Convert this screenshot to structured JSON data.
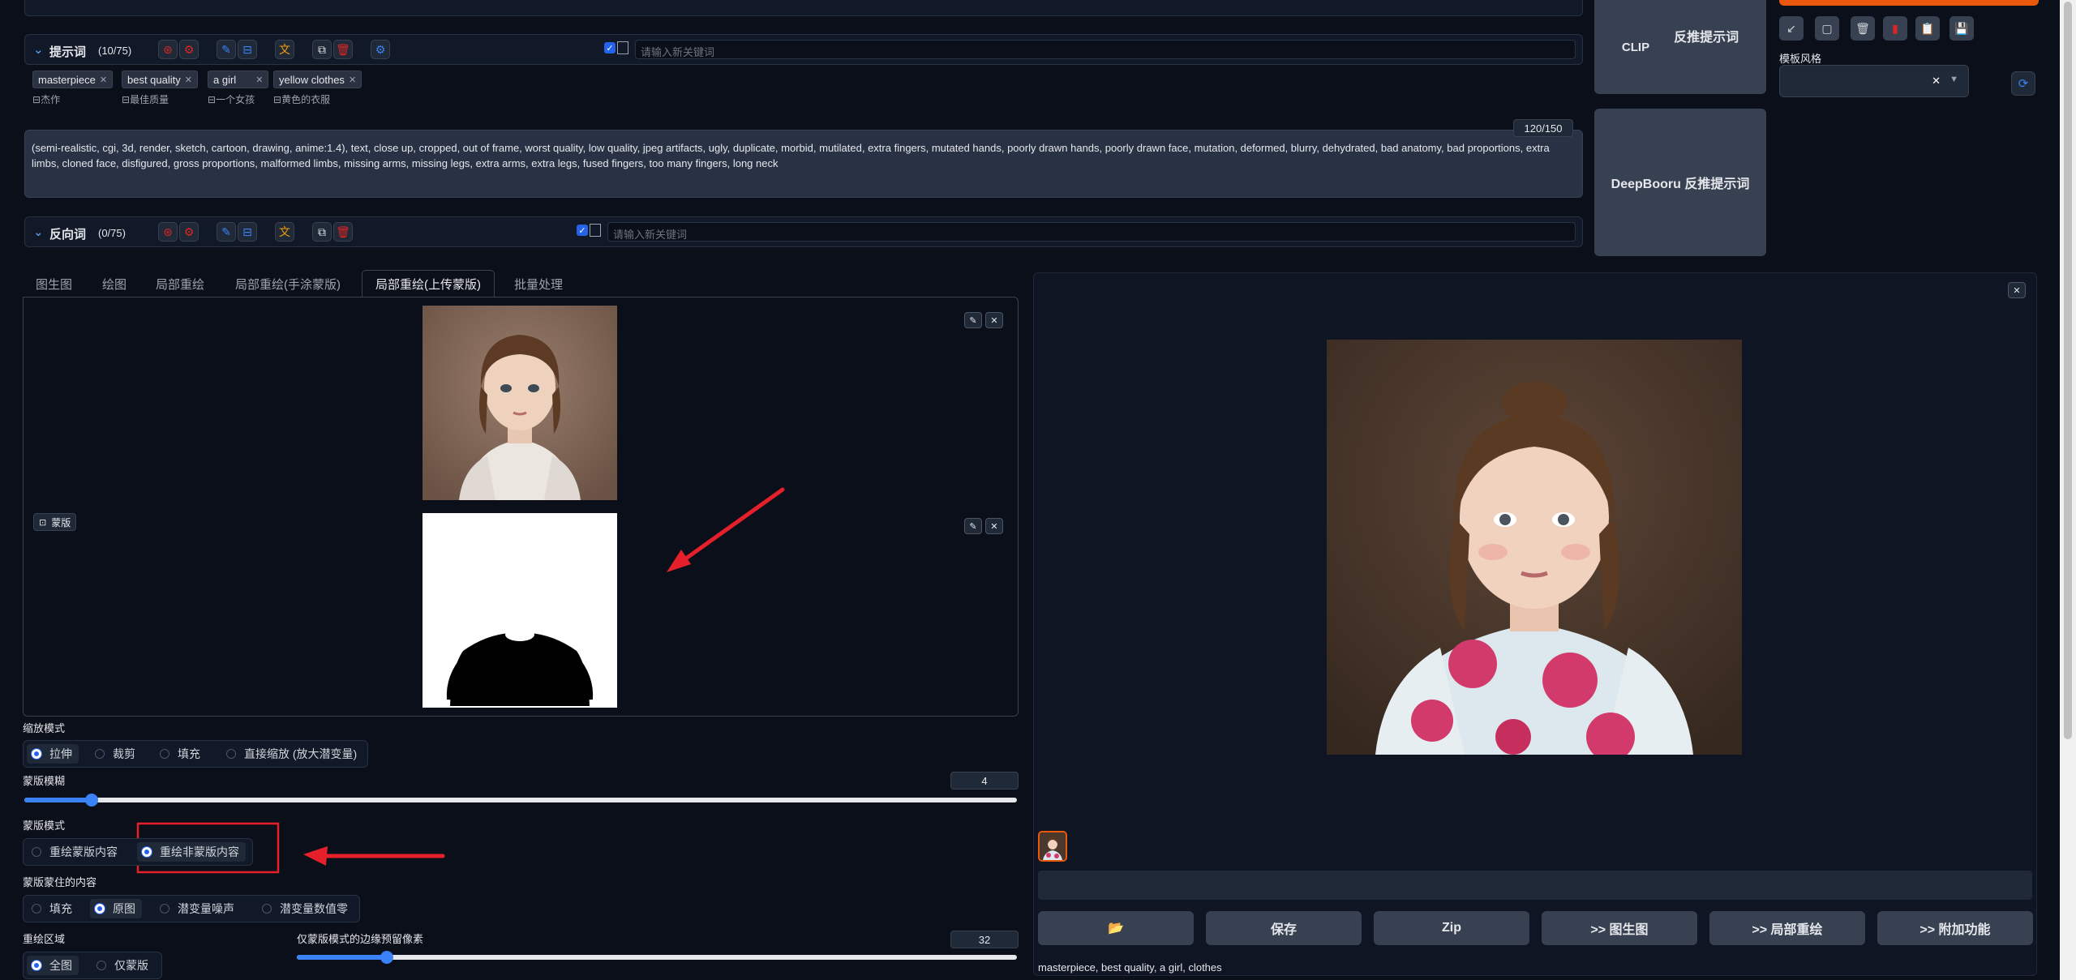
{
  "prompt": {
    "title": "提示词",
    "count": "(10/75)",
    "keyword_placeholder": "请输入新关键词",
    "tags": [
      {
        "text": "masterpiece",
        "translation": "杰作"
      },
      {
        "text": "best quality",
        "translation": "最佳质量"
      },
      {
        "text": "a girl",
        "translation": "一个女孩"
      },
      {
        "text": "yellow clothes",
        "translation": "黄色的衣服"
      }
    ]
  },
  "negative_textarea": {
    "counter": "120/150",
    "text": "(semi-realistic, cgi, 3d, render, sketch, cartoon, drawing, anime:1.4), text, close up, cropped, out of frame, worst quality, low quality, jpeg artifacts, ugly, duplicate, morbid, mutilated, extra fingers, mutated hands, poorly drawn hands, poorly drawn face, mutation, deformed, blurry, dehydrated, bad anatomy, bad proportions, extra limbs, cloned face, disfigured, gross proportions, malformed limbs, missing arms, missing legs, extra arms, extra legs, fused fingers, too many fingers, long neck"
  },
  "negative_prompt": {
    "title": "反向词",
    "count": "(0/75)",
    "keyword_placeholder": "请输入新关键词"
  },
  "interrogate": {
    "clip_label": "CLIP",
    "clip_action": "反推提示词",
    "deepbooru_label": "DeepBooru 反推提示词"
  },
  "style": {
    "label": "模板风格"
  },
  "tabs": [
    "图生图",
    "绘图",
    "局部重绘",
    "局部重绘(手涂蒙版)",
    "局部重绘(上传蒙版)",
    "批量处理"
  ],
  "active_tab": "局部重绘(上传蒙版)",
  "mask_label": "蒙版",
  "resize_mode": {
    "label": "缩放模式",
    "options": [
      "拉伸",
      "裁剪",
      "填充",
      "直接缩放 (放大潜变量)"
    ],
    "selected": "拉伸"
  },
  "mask_blur": {
    "label": "蒙版模糊",
    "value": "4",
    "fraction": 0.068
  },
  "mask_mode": {
    "label": "蒙版模式",
    "options": [
      "重绘蒙版内容",
      "重绘非蒙版内容"
    ],
    "selected": "重绘非蒙版内容"
  },
  "masked_content": {
    "label": "蒙版蒙住的内容",
    "options": [
      "填充",
      "原图",
      "潜变量噪声",
      "潜变量数值零"
    ],
    "selected": "原图"
  },
  "inpaint_area": {
    "label": "重绘区域",
    "options": [
      "全图",
      "仅蒙版"
    ],
    "selected": "全图"
  },
  "padding": {
    "label": "仅蒙版模式的边缘预留像素",
    "value": "32",
    "fraction": 0.125
  },
  "output": {
    "buttons": [
      "📂",
      "保存",
      "Zip",
      ">> 图生图",
      ">> 局部重绘",
      ">> 附加功能"
    ],
    "caption": "masterpiece, best quality, a girl, clothes"
  },
  "colors": {
    "accent": "#3b82f6",
    "annotation": "#e5202b",
    "orange": "#ea580c"
  }
}
